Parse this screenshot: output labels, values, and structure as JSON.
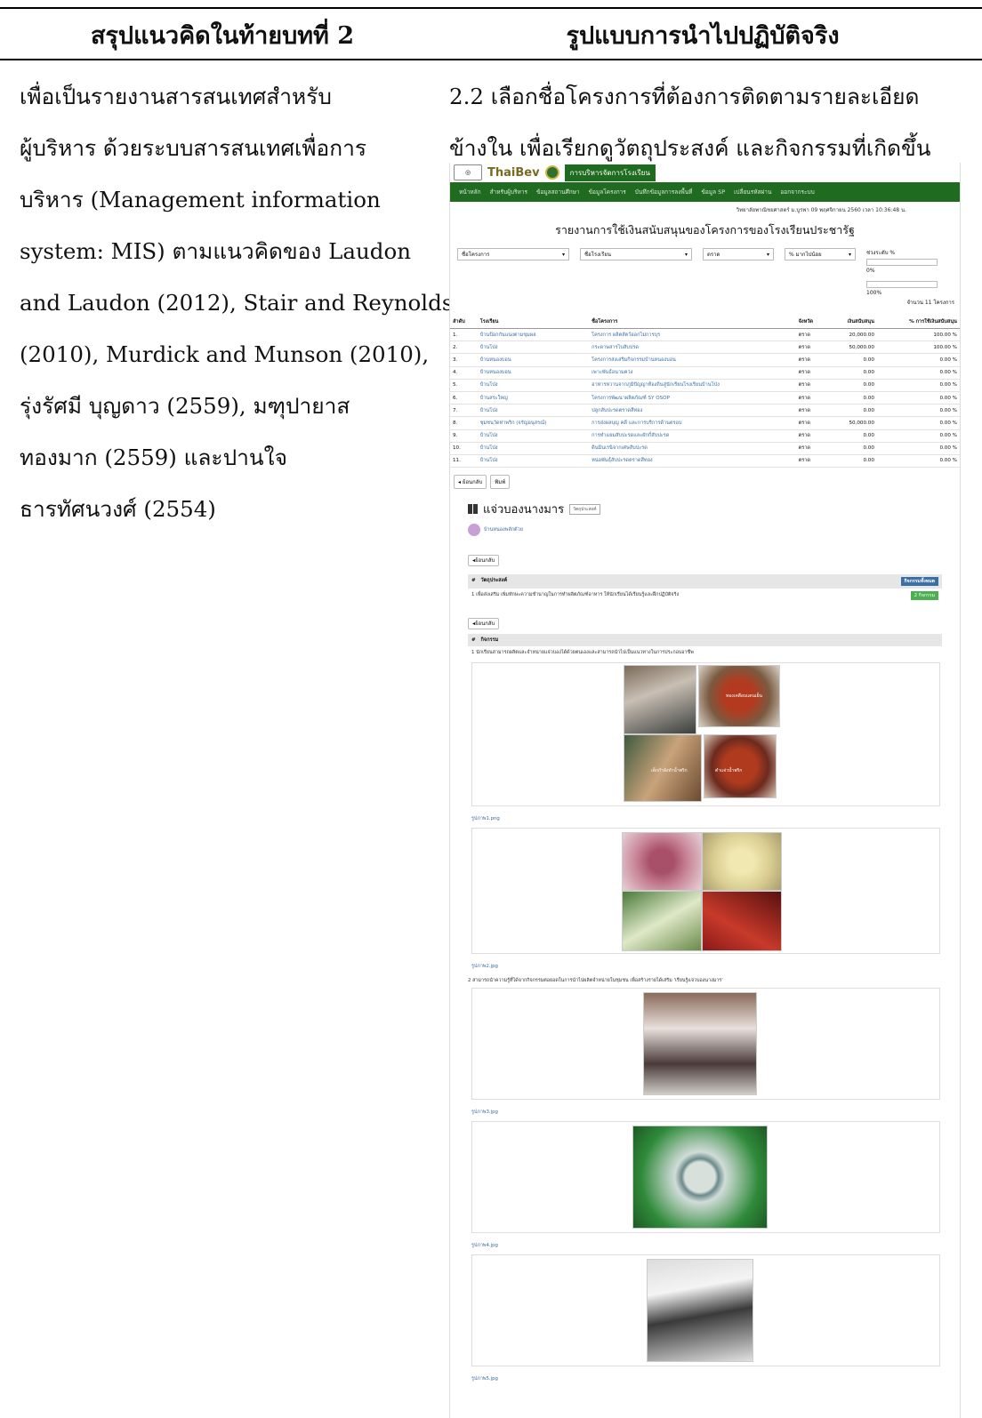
{
  "header": {
    "left_title": "สรุปแนวคิดในท้ายบทที่ 2",
    "right_title": "รูปแบบการนำไปปฏิบัติจริง"
  },
  "left_paragraph_lines": [
    "เพื่อเป็นรายงานสารสนเทศสำหรับ",
    "ผู้บริหาร ด้วยระบบสารสนเทศเพื่อการ",
    "บริหาร (Management information",
    "system: MIS) ตามแนวคิดของ Laudon",
    "and Laudon (2012), Stair and Reynolds",
    "(2010), Murdick and Munson (2010),",
    "รุ่งรัศมี บุญดาว (2559), มฑุปายาส",
    "ทองมาก (2559) และปานใจ",
    "ธารทัศนวงศ์ (2554)"
  ],
  "right_paragraph_lines": [
    "2.2  เลือกชื่อโครงการที่ต้องการติดตามรายละเอียด",
    "ข้างใน เพื่อเรียกดูวัตถุประสงค์ และกิจกรรมที่เกิดขึ้น"
  ],
  "app": {
    "brand_logo": "ThaiBev",
    "brand_title": "การบริหารจัดการโรงเรียน",
    "nav_items": [
      "หน้าหลัก",
      "สำหรับผู้บริหาร",
      "ข้อมูลสถานศึกษา",
      "ข้อมูลโครงการ",
      "บันทึกข้อมูลการลงพื้นที่",
      "ข้อมูล SP",
      "เปลี่ยนรหัสผ่าน",
      "ออกจากระบบ"
    ],
    "user_line": "วิทยาลัยพาณิชยศาสตร์ ม.บูรพา  09 พฤศจิกายน 2560 เวลา 10:36:48 น.",
    "report_title": "รายงานการใช้เงินสนับสนุนของโครงการของโรงเรียนประชารัฐ",
    "filters": [
      "ชื่อโครงการ",
      "ชื่อโรงเรียน",
      "ตราด",
      "% มากไปน้อย"
    ],
    "range_label": "ช่วงระดับ %",
    "range_min": "0%",
    "range_max": "100%",
    "count_label": "จำนวน 11 โครงการ",
    "table_headers": [
      "ลำดับ",
      "โรงเรียน",
      "ชื่อโครงการ",
      "จังหวัด",
      "เงินสนับสนุน",
      "% การใช้เงินสนับสนุน"
    ],
    "rows": [
      [
        "1.",
        "บ้านป้อกกันแนงตามขุมผล",
        "โครงการ ผลิตสัตว์ออกไม่การบุร",
        "ตราด",
        "20,000.00",
        "100.00 %"
      ],
      [
        "2.",
        "บ้านโป่ง",
        "กระดาษสารไบสับปรด",
        "ตราด",
        "50,000.00",
        "100.00 %"
      ],
      [
        "3.",
        "บ้านหนองบอน",
        "โครงการส่งเสริมกิจกรรมบ้านหนองบอน",
        "ตราด",
        "0.00",
        "0.00 %"
      ],
      [
        "4.",
        "บ้านหนองบอน",
        "เพาะพันธ์อนามคว่ง",
        "ตราด",
        "0.00",
        "0.00 %"
      ],
      [
        "5.",
        "บ้านโป่ง",
        "อาหารหวานจากภูมิปัญญาท้องถิ่นสู่นักเรียนโรงเรียนบ้านโป่ง",
        "ตราด",
        "0.00",
        "0.00 %"
      ],
      [
        "6.",
        "บ้านสระใหญ่",
        "โครงการพัฒนาผลิตภัณฑ์ SY OSOP",
        "ตราด",
        "0.00",
        "0.00 %"
      ],
      [
        "7.",
        "บ้านโป่ง",
        "ปลูกสับปะรดตราดสีทอง",
        "ตราด",
        "0.00",
        "0.00 %"
      ],
      [
        "8.",
        "ชุมชนวัดท่าพริก (จรัญอนุสรณ์)",
        "การส่งผลบุญ คดี และการบริการด้านตรอบ",
        "ตราด",
        "50,000.00",
        "0.00 %"
      ],
      [
        "9.",
        "บ้านโป่ง",
        "การทำแยมสับปะรดและผักกี่สับปะรด",
        "ตราด",
        "0.00",
        "0.00 %"
      ],
      [
        "10.",
        "บ้านโป่ง",
        "ดินมินเรนิจากเศษสับปะรด",
        "ตราด",
        "0.00",
        "0.00 %"
      ],
      [
        "11.",
        "บ้านโป่ง",
        "หน่อพันธุ์สับปะรดตราดสีทอง",
        "ตราด",
        "0.00",
        "0.00 %"
      ]
    ],
    "btn_back": "ย้อนกลับ",
    "btn_print": "พิมพ์",
    "school_title": "แจ่วบองนางมาร",
    "school_tag": "วัตถุประสงค์",
    "school_name": "บ้านหนองพลักตัวย",
    "back_small": "ย้อนกลับ",
    "objectives_head": [
      "#",
      "วัตถุประสงค์"
    ],
    "objectives_btn": "กิจกรรมทั้งหมด",
    "objective_1": "1   เพื่อส่งเสริม เพิ่มทักษะความชำนาญในการทำผลิตภัณฑ์อาหาร ให้นักเรียนได้เรียนรู้และฝึกปฏิบัติจริง",
    "objective_1_btn": "2 กิจกรรม",
    "back_small2": "ย้อนกลับ",
    "activity_head": [
      "#",
      "กิจกรรม"
    ],
    "activity_1": "1   นักเรียนสามารถผลิตและจำหน่ายแจ่วบองได้ด้วยตนเองและสามารถนำไปเป็นแนวทางในการประกอบอาชีพ",
    "photo_labels": [
      "ทองเคลือบแดนเย็น",
      "เด็กกำลังทำน้ำพริก",
      "ตำแจ่วน้ำพริก"
    ],
    "captions": [
      "รูปภาพ1.png",
      "รูปภาพ2.jpg",
      "รูปภาพ3.jpg",
      "รูปภาพ4.jpg",
      "รูปภาพ5.jpg"
    ],
    "activity_2": "2   สามารถนำความรู้ที่ได้จากกิจกรรมต่อยอดในการนำไปผลิตจำหน่ายในชุมชน เพื่อสร้างรายได้เสริม 'เรียนรู้แจ่วบองนางมาร'"
  },
  "colors": {
    "nav_green": "#1f6b1f",
    "link_blue": "#3a6ea5"
  }
}
